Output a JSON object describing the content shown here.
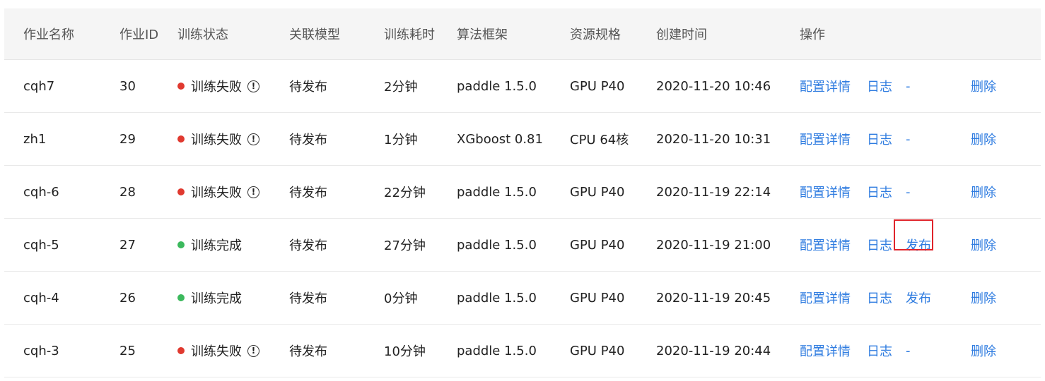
{
  "colors": {
    "fail": "#e0392f",
    "success": "#3cb95d",
    "link": "#2f7ce0",
    "highlight": "#e0242b"
  },
  "header": {
    "name": "作业名称",
    "id": "作业ID",
    "status": "训练状态",
    "model": "关联模型",
    "duration": "训练耗时",
    "framework": "算法框架",
    "resource": "资源规格",
    "created": "创建时间",
    "ops": "操作"
  },
  "rows": [
    {
      "name": "cqh7",
      "id": "30",
      "status": "训练失败",
      "state": "fail",
      "model": "待发布",
      "duration": "2分钟",
      "framework": "paddle 1.5.0",
      "resource": "GPU P40",
      "created": "2020-11-20 10:46",
      "op_config": "配置详情",
      "op_log": "日志",
      "op_publish": "-",
      "op_delete": "删除"
    },
    {
      "name": "zh1",
      "id": "29",
      "status": "训练失败",
      "state": "fail",
      "model": "待发布",
      "duration": "1分钟",
      "framework": "XGboost 0.81",
      "resource": "CPU 64核",
      "created": "2020-11-20 10:31",
      "op_config": "配置详情",
      "op_log": "日志",
      "op_publish": "-",
      "op_delete": "删除"
    },
    {
      "name": "cqh-6",
      "id": "28",
      "status": "训练失败",
      "state": "fail",
      "model": "待发布",
      "duration": "22分钟",
      "framework": "paddle 1.5.0",
      "resource": "GPU P40",
      "created": "2020-11-19 22:14",
      "op_config": "配置详情",
      "op_log": "日志",
      "op_publish": "-",
      "op_delete": "删除"
    },
    {
      "name": "cqh-5",
      "id": "27",
      "status": "训练完成",
      "state": "success",
      "model": "待发布",
      "duration": "27分钟",
      "framework": "paddle 1.5.0",
      "resource": "GPU P40",
      "created": "2020-11-19 21:00",
      "op_config": "配置详情",
      "op_log": "日志",
      "op_publish": "发布",
      "op_delete": "删除"
    },
    {
      "name": "cqh-4",
      "id": "26",
      "status": "训练完成",
      "state": "success",
      "model": "待发布",
      "duration": "0分钟",
      "framework": "paddle 1.5.0",
      "resource": "GPU P40",
      "created": "2020-11-19 20:45",
      "op_config": "配置详情",
      "op_log": "日志",
      "op_publish": "发布",
      "op_delete": "删除"
    },
    {
      "name": "cqh-3",
      "id": "25",
      "status": "训练失败",
      "state": "fail",
      "model": "待发布",
      "duration": "10分钟",
      "framework": "paddle 1.5.0",
      "resource": "GPU P40",
      "created": "2020-11-19 20:44",
      "op_config": "配置详情",
      "op_log": "日志",
      "op_publish": "-",
      "op_delete": "删除"
    }
  ],
  "warn_glyph": "!"
}
